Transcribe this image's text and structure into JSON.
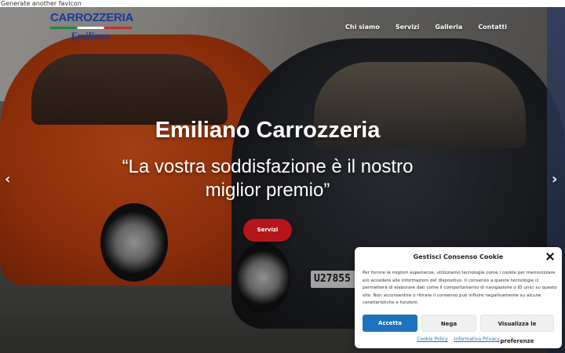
{
  "top_note": "Generate another favicon",
  "header": {
    "logo_main": "CARROZZERIA",
    "logo_sub": "Emiliano",
    "nav": [
      "Chi siamo",
      "Servizi",
      "Galleria",
      "Contatti"
    ]
  },
  "hero": {
    "title": "Emiliano Carrozzeria",
    "subtitle": "“La vostra soddisfazione è il nostro miglior premio”",
    "cta_label": "Servizi",
    "arrow_left": "‹",
    "arrow_right": "›",
    "plate_text": "U27855"
  },
  "cookie": {
    "title": "Gestisci Consenso Cookie",
    "body": "Per fornire le migliori esperienze, utilizziamo tecnologie come i cookie per memorizzare e/o accedere alle informazioni del dispositivo. Il consenso a queste tecnologie ci permetterà di elaborare dati come il comportamento di navigazione o ID unici su questo sito. Non acconsentire o ritirare il consenso può influire negativamente su alcune caratteristiche e funzioni.",
    "accept": "Accetta",
    "deny": "Nega",
    "preferences": "Visualizza le preferenze",
    "link_cookie_policy": "Cookie Policy",
    "link_privacy": "Informativa Privacy"
  },
  "colors": {
    "cta": "#b5161b",
    "accept": "#1e73be",
    "logo_blue": "#1b3a9c"
  }
}
